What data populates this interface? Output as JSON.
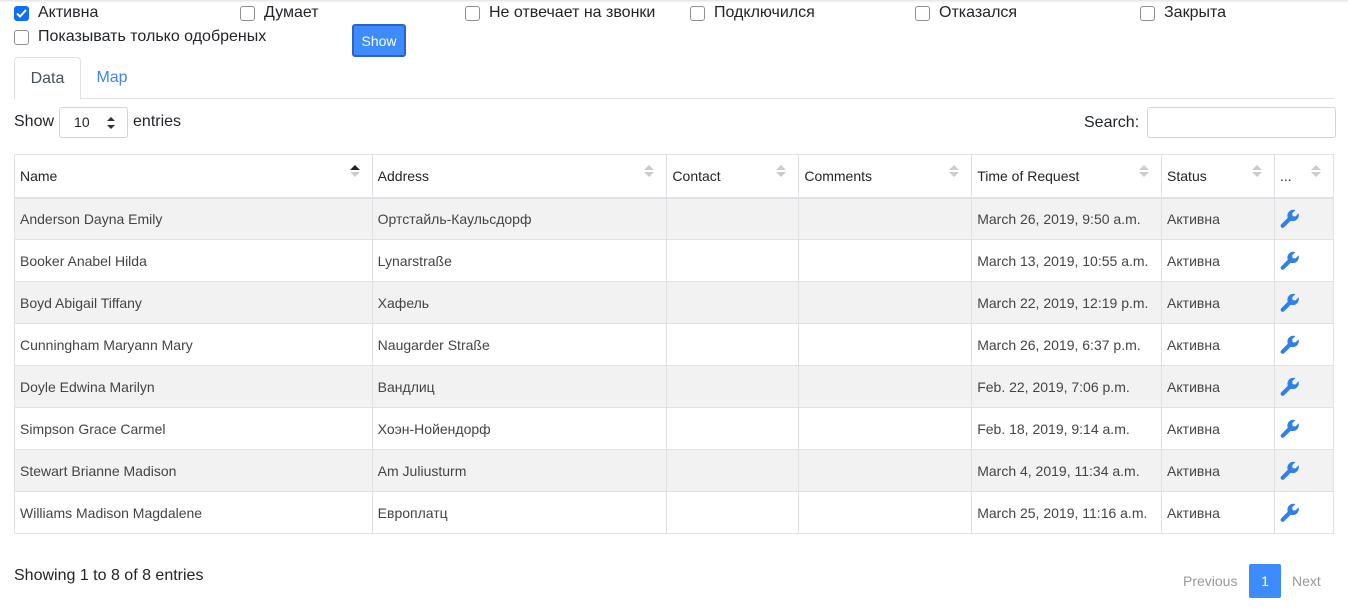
{
  "filters": [
    {
      "label": "Активна",
      "checked": true
    },
    {
      "label": "Думает",
      "checked": false
    },
    {
      "label": "Не отвечает на звонки",
      "checked": false
    },
    {
      "label": "Подключился",
      "checked": false
    },
    {
      "label": "Отказался",
      "checked": false
    },
    {
      "label": "Закрыта",
      "checked": false
    },
    {
      "label": "Показывать только одобреных",
      "checked": false
    }
  ],
  "show_button": "Show",
  "tabs": [
    {
      "label": "Data",
      "active": true
    },
    {
      "label": "Map",
      "active": false
    }
  ],
  "length": {
    "prefix": "Show",
    "value": "10",
    "suffix": "entries"
  },
  "search": {
    "label": "Search:",
    "value": ""
  },
  "table": {
    "columns": [
      "Name",
      "Address",
      "Contact",
      "Comments",
      "Time of Request",
      "Status",
      "..."
    ],
    "rows": [
      {
        "name": "Anderson Dayna Emily",
        "address": "Ортстайль-Каульсдорф",
        "contact": "",
        "comments": "",
        "time": "March 26, 2019, 9:50 a.m.",
        "status": "Активна"
      },
      {
        "name": "Booker Anabel Hilda",
        "address": "Lynarstraße",
        "contact": "",
        "comments": "",
        "time": "March 13, 2019, 10:55 a.m.",
        "status": "Активна"
      },
      {
        "name": "Boyd Abigail Tiffany",
        "address": "Хафель",
        "contact": "",
        "comments": "",
        "time": "March 22, 2019, 12:19 p.m.",
        "status": "Активна"
      },
      {
        "name": "Cunningham Maryann Mary",
        "address": "Naugarder Straße",
        "contact": "",
        "comments": "",
        "time": "March 26, 2019, 6:37 p.m.",
        "status": "Активна"
      },
      {
        "name": "Doyle Edwina Marilyn",
        "address": "Вандлиц",
        "contact": "",
        "comments": "",
        "time": "Feb. 22, 2019, 7:06 p.m.",
        "status": "Активна"
      },
      {
        "name": "Simpson Grace Carmel",
        "address": "Хоэн-Нойендорф",
        "contact": "",
        "comments": "",
        "time": "Feb. 18, 2019, 9:14 a.m.",
        "status": "Активна"
      },
      {
        "name": "Stewart Brianne Madison",
        "address": "Am Juliusturm",
        "contact": "",
        "comments": "",
        "time": "March 4, 2019, 11:34 a.m.",
        "status": "Активна"
      },
      {
        "name": "Williams Madison Magdalene",
        "address": "Европлатц",
        "contact": "",
        "comments": "",
        "time": "March 25, 2019, 11:16 a.m.",
        "status": "Активна"
      }
    ],
    "action_icon": "wrench-icon"
  },
  "info": "Showing 1 to 8 of 8 entries",
  "pagination": {
    "previous": "Previous",
    "current": "1",
    "next": "Next"
  },
  "colors": {
    "accent": "#3d8bfd",
    "link": "#3f86e6",
    "stripe": "#f2f2f2"
  }
}
